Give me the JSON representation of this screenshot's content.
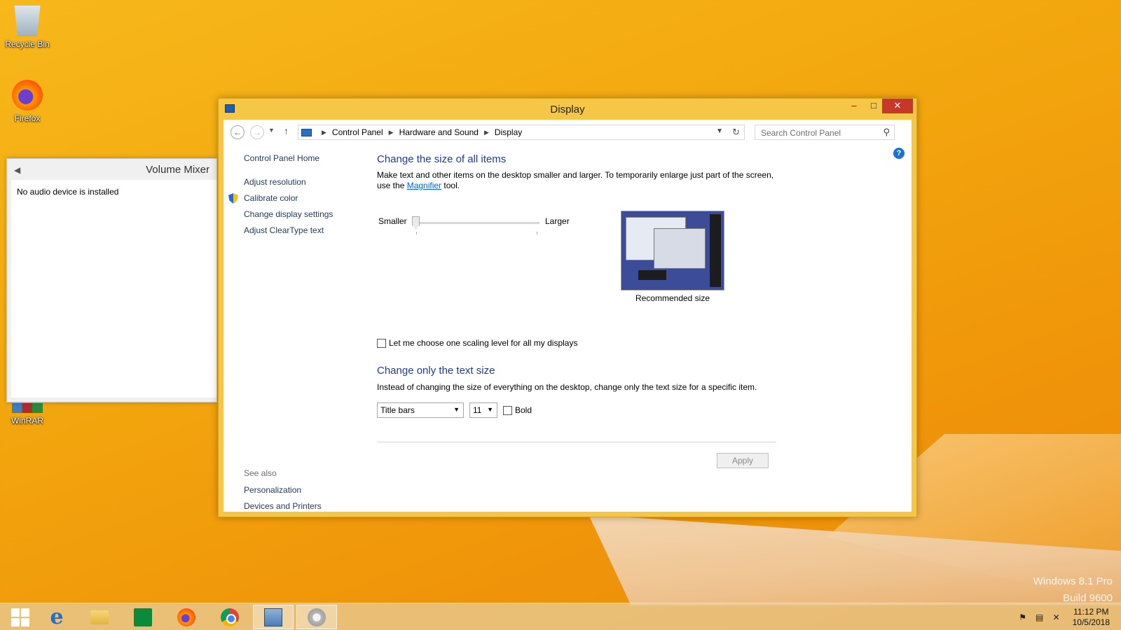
{
  "desktop": {
    "icons": [
      {
        "label": "Recycle Bin"
      },
      {
        "label": "Firefox"
      },
      {
        "label": "WinRAR"
      }
    ],
    "watermark": {
      "line1": "Windows 8.1 Pro",
      "line2": "Build 9600"
    }
  },
  "volume_mixer": {
    "title": "Volume Mixer",
    "message": "No audio device is installed"
  },
  "window": {
    "title": "Display",
    "controls": {
      "minimize": "–",
      "maximize": "□",
      "close": "✕"
    },
    "breadcrumb": [
      "Control Panel",
      "Hardware and Sound",
      "Display"
    ],
    "search_placeholder": "Search Control Panel",
    "help": "?",
    "left_pane": {
      "home": "Control Panel Home",
      "links": [
        "Adjust resolution",
        "Calibrate color",
        "Change display settings",
        "Adjust ClearType text"
      ],
      "see_also_header": "See also",
      "see_also": [
        "Personalization",
        "Devices and Printers"
      ]
    },
    "content": {
      "heading1": "Change the size of all items",
      "desc1_before": "Make text and other items on the desktop smaller and larger. To temporarily enlarge just part of the screen, use the ",
      "desc1_link": "Magnifier",
      "desc1_after": " tool.",
      "slider_smaller": "Smaller",
      "slider_larger": "Larger",
      "slider_level": 0,
      "preview_label": "Recommended size",
      "checkbox_label": "Let me choose one scaling level for all my displays",
      "heading2": "Change only the text size",
      "desc2": "Instead of changing the size of everything on the desktop, change only the text size for a specific item.",
      "item_select": "Title bars",
      "size_select": "11",
      "bold_label": "Bold",
      "apply_label": "Apply"
    }
  },
  "taskbar": {
    "items": [
      "start",
      "internet-explorer",
      "file-explorer",
      "store",
      "firefox",
      "chrome",
      "control-panel",
      "volume-mixer"
    ],
    "clock_time": "11:12 PM",
    "clock_date": "10/5/2018"
  }
}
